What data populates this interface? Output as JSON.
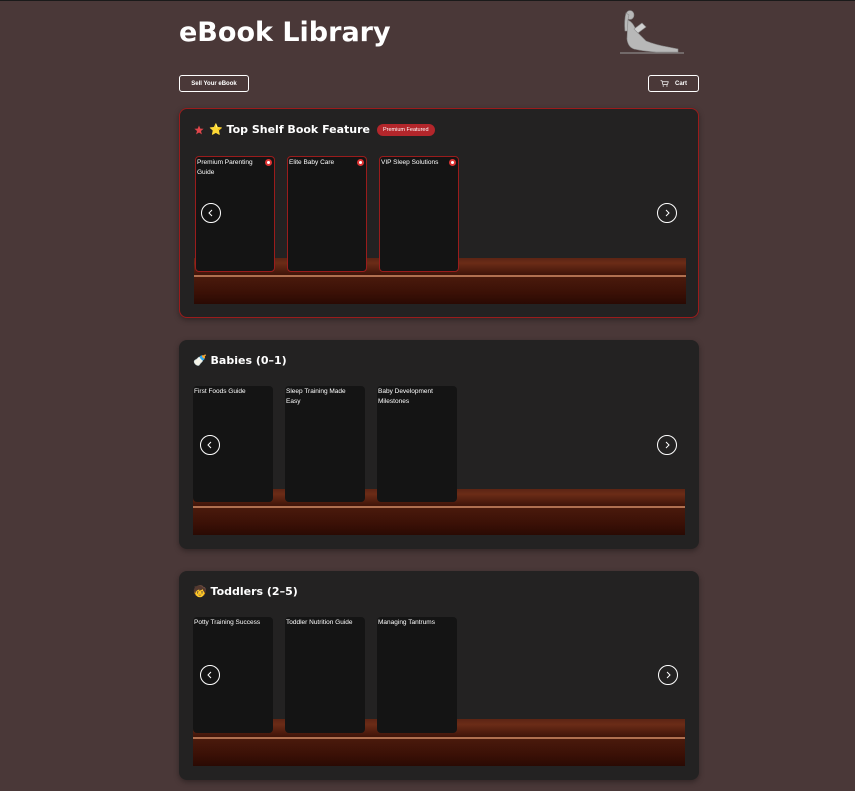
{
  "header": {
    "title": "eBook Library",
    "logo_icon": "woman-reading-icon"
  },
  "toolbar": {
    "sell_label": "Sell Your eBook",
    "cart_label": "Cart",
    "cart_icon": "cart-icon"
  },
  "colors": {
    "background": "#4a3838",
    "panel": "#232222",
    "accent_red": "#b3262b",
    "shelf_wood": "#6b2c17"
  },
  "sections": [
    {
      "icon": "star-icon",
      "title": "⭐ Top Shelf Book Feature",
      "badge": "Premium Featured",
      "books": [
        {
          "title": "Premium Parenting Guide"
        },
        {
          "title": "Elite Baby Care"
        },
        {
          "title": "VIP Sleep Solutions"
        }
      ]
    },
    {
      "icon": "baby-bottle-icon",
      "title": "🍼 Babies (0–1)",
      "books": [
        {
          "title": "First Foods Guide"
        },
        {
          "title": "Sleep Training Made Easy"
        },
        {
          "title": "Baby Development Milestones"
        }
      ]
    },
    {
      "icon": "child-icon",
      "title": "🧒 Toddlers (2–5)",
      "books": [
        {
          "title": "Potty Training Success"
        },
        {
          "title": "Toddler Nutrition Guide"
        },
        {
          "title": "Managing Tantrums"
        }
      ]
    }
  ]
}
